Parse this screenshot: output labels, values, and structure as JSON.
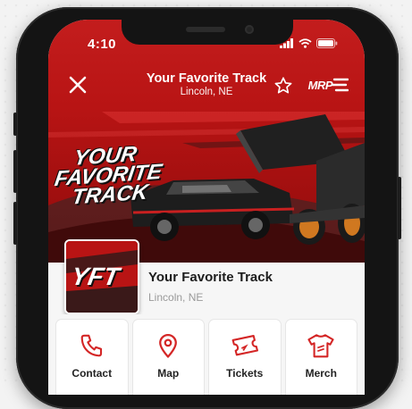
{
  "status_bar": {
    "time": "4:10"
  },
  "nav": {
    "title": "Your Favorite Track",
    "subtitle": "Lincoln, NE",
    "logo_text": "MRP"
  },
  "banner": {
    "headline_line1": "YOUR",
    "headline_line2": "FAVORITE",
    "headline_line3": "TRACK"
  },
  "track": {
    "logo_text": "YFT",
    "name": "Your Favorite Track",
    "location": "Lincoln, NE"
  },
  "actions": [
    {
      "label": "Contact",
      "icon": "phone-icon"
    },
    {
      "label": "Map",
      "icon": "map-pin-icon"
    },
    {
      "label": "Tickets",
      "icon": "ticket-icon"
    },
    {
      "label": "Merch",
      "icon": "tshirt-icon"
    }
  ],
  "colors": {
    "brand_red": "#c31d1d",
    "dark": "#141414"
  }
}
